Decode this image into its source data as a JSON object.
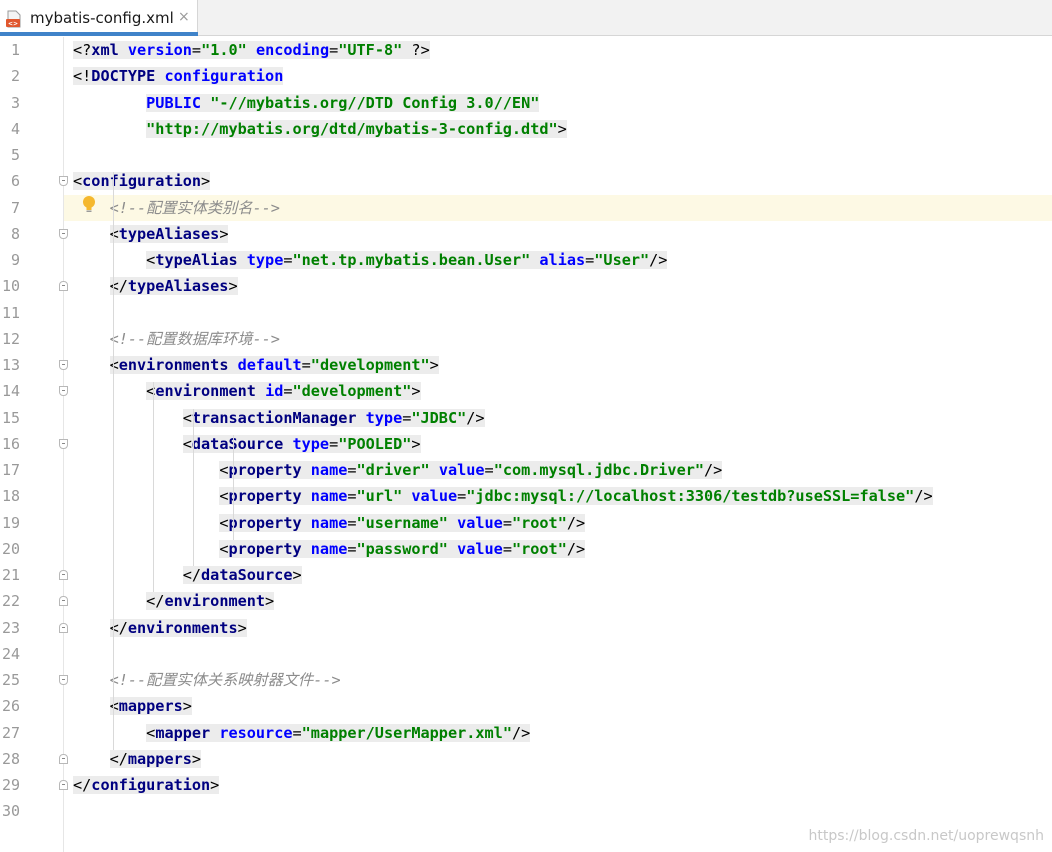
{
  "tab": {
    "title": "mybatis-config.xml",
    "close": "×",
    "icon": "xml-file-icon"
  },
  "current_line": 7,
  "lines": [
    "<?xml version=\"1.0\" encoding=\"UTF-8\" ?>",
    "<!DOCTYPE configuration",
    "        PUBLIC \"-//mybatis.org//DTD Config 3.0//EN\"",
    "        \"http://mybatis.org/dtd/mybatis-3-config.dtd\">",
    "",
    "<configuration>",
    "    <!--配置实体类别名-->",
    "    <typeAliases>",
    "        <typeAlias type=\"net.tp.mybatis.bean.User\" alias=\"User\"/>",
    "    </typeAliases>",
    "",
    "    <!--配置数据库环境-->",
    "    <environments default=\"development\">",
    "        <environment id=\"development\">",
    "            <transactionManager type=\"JDBC\"/>",
    "            <dataSource type=\"POOLED\">",
    "                <property name=\"driver\" value=\"com.mysql.jdbc.Driver\"/>",
    "                <property name=\"url\" value=\"jdbc:mysql://localhost:3306/testdb?useSSL=false\"/>",
    "                <property name=\"username\" value=\"root\"/>",
    "                <property name=\"password\" value=\"root\"/>",
    "            </dataSource>",
    "        </environment>",
    "    </environments>",
    "",
    "    <!--配置实体关系映射器文件-->",
    "    <mappers>",
    "        <mapper resource=\"mapper/UserMapper.xml\"/>",
    "    </mappers>",
    "</configuration>",
    ""
  ],
  "watermark": "https://blog.csdn.net/uoprewqsnh"
}
